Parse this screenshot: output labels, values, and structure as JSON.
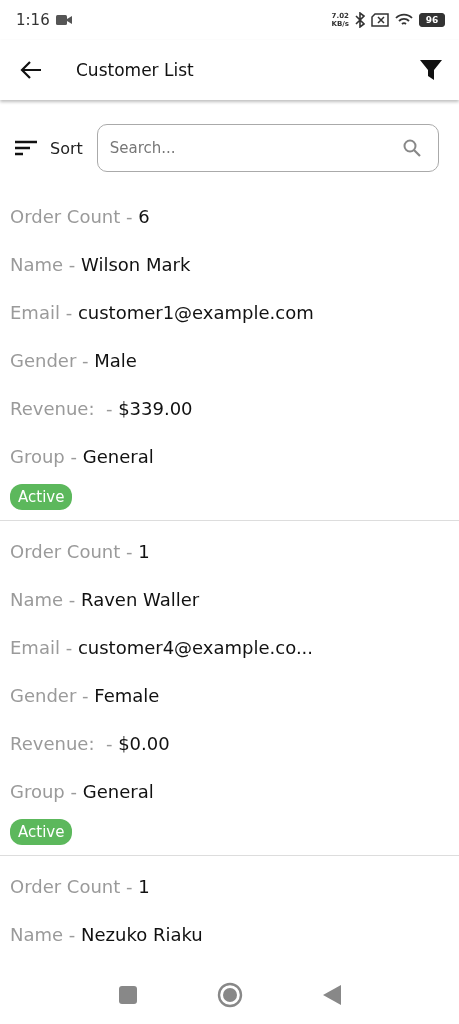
{
  "status_bar": {
    "time": "1:16",
    "speed_value": "7.02",
    "speed_unit": "KB/s",
    "battery": "96"
  },
  "app_bar": {
    "title": "Customer List"
  },
  "toolbar": {
    "sort_label": "Sort",
    "search": {
      "placeholder": "Search..."
    }
  },
  "customers": [
    {
      "fields": [
        {
          "label": "Order Count - ",
          "value": "6"
        },
        {
          "label": "Name - ",
          "value": "Wilson Mark"
        },
        {
          "label": "Email - ",
          "value": "customer1@example.com"
        },
        {
          "label": "Gender - ",
          "value": "Male"
        },
        {
          "label": "Revenue:  - ",
          "value": "$339.00"
        },
        {
          "label": "Group - ",
          "value": "General"
        }
      ],
      "status": {
        "label": "Active",
        "active": true
      }
    },
    {
      "fields": [
        {
          "label": "Order Count - ",
          "value": "1"
        },
        {
          "label": "Name - ",
          "value": "Raven Waller"
        },
        {
          "label": "Email - ",
          "value": "customer4@example.co..."
        },
        {
          "label": "Gender - ",
          "value": "Female"
        },
        {
          "label": "Revenue:  - ",
          "value": "$0.00"
        },
        {
          "label": "Group - ",
          "value": "General"
        }
      ],
      "status": {
        "label": "Active",
        "active": true
      }
    },
    {
      "fields": [
        {
          "label": "Order Count - ",
          "value": "1"
        },
        {
          "label": "Name - ",
          "value": "Nezuko Riaku"
        }
      ]
    }
  ]
}
